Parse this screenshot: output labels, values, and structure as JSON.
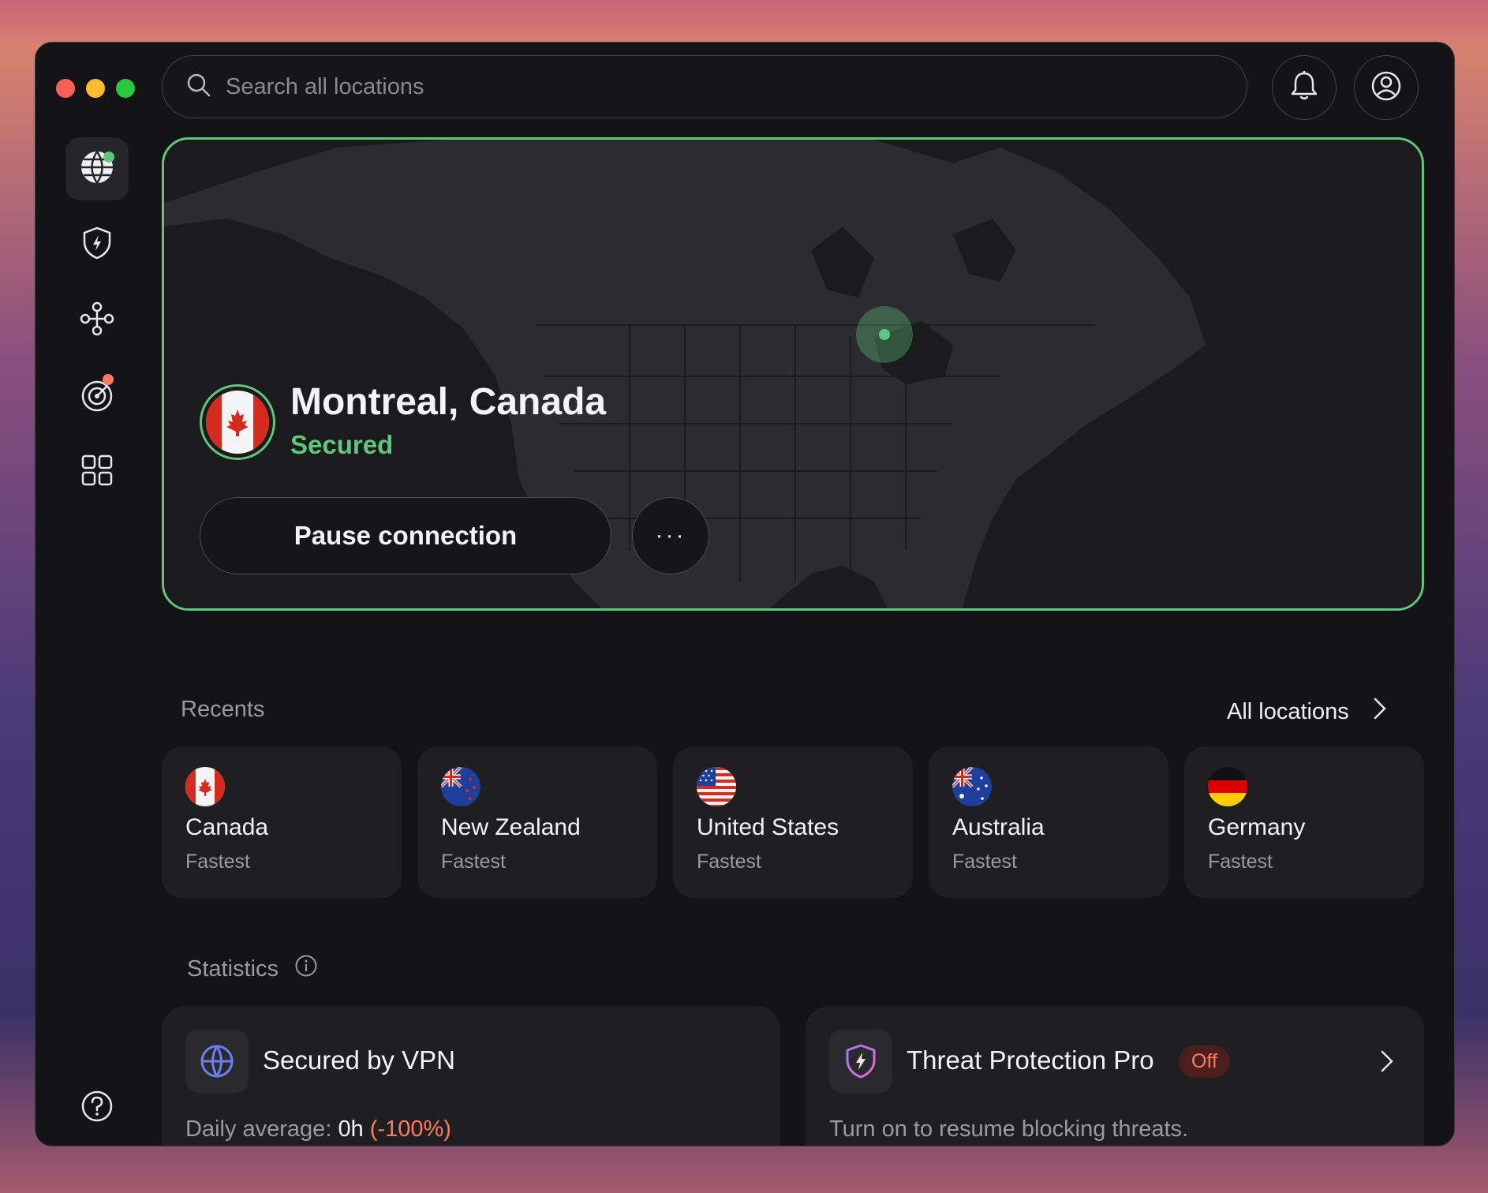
{
  "search": {
    "placeholder": "Search all locations"
  },
  "header": {
    "notifications_icon": "bell-icon",
    "account_icon": "user-circle-icon"
  },
  "sidebar": {
    "items": [
      {
        "icon": "globe-icon",
        "active": true,
        "status_dot": "#5fc77c"
      },
      {
        "icon": "shield-bolt-icon"
      },
      {
        "icon": "meshnet-icon"
      },
      {
        "icon": "radar-icon",
        "status_dot": "#ff7a62"
      },
      {
        "icon": "grid-icon"
      }
    ],
    "help_icon": "question-icon"
  },
  "connection": {
    "location": "Montreal, Canada",
    "status": "Secured",
    "pause_label": "Pause connection",
    "more_label": "···",
    "accent": "#5fc77c"
  },
  "recents": {
    "label": "Recents",
    "all_locations_label": "All locations",
    "items": [
      {
        "country": "Canada",
        "sub": "Fastest"
      },
      {
        "country": "New Zealand",
        "sub": "Fastest"
      },
      {
        "country": "United States",
        "sub": "Fastest"
      },
      {
        "country": "Australia",
        "sub": "Fastest"
      },
      {
        "country": "Germany",
        "sub": "Fastest"
      }
    ]
  },
  "statistics": {
    "label": "Statistics",
    "vpn": {
      "title": "Secured by VPN",
      "daily_label": "Daily average:",
      "daily_value": "0h",
      "daily_change": "(-100%)",
      "change_color": "#ff7a62"
    },
    "threat": {
      "title": "Threat Protection Pro",
      "badge": "Off",
      "sub": "Turn on to resume blocking threats."
    }
  }
}
